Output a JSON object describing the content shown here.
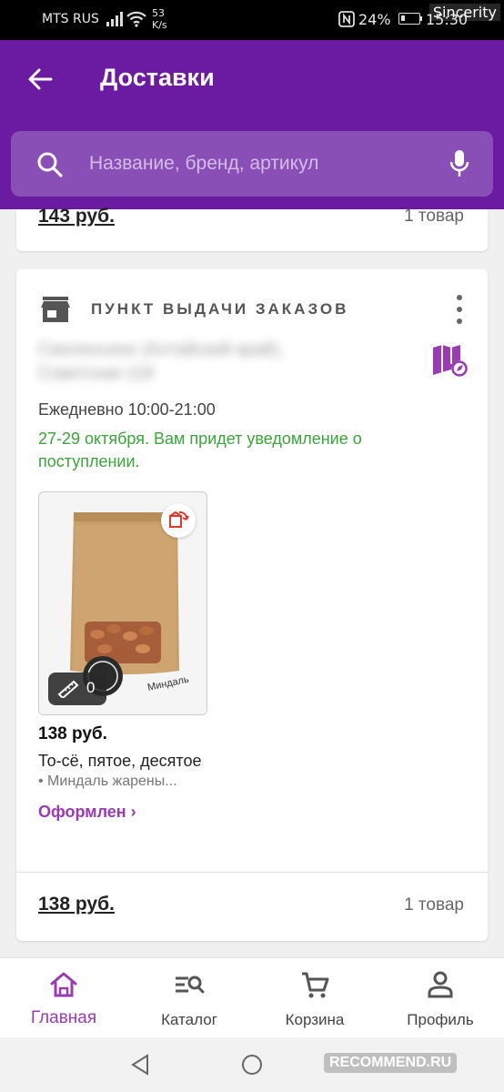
{
  "status_bar": {
    "carrier": "MTS RUS",
    "speed_value": "53",
    "speed_unit": "K/s",
    "battery": "24%",
    "time": "15:30",
    "watermark": "Sincerity"
  },
  "header": {
    "title": "Доставки",
    "back_icon": "arrow-left-icon"
  },
  "search": {
    "placeholder": "Название, бренд, артикул",
    "icon": "search-icon",
    "mic_icon": "microphone-icon"
  },
  "previous_card": {
    "total": "143 руб.",
    "count": "1 товар"
  },
  "pickup_card": {
    "title": "ПУНКТ ВЫДАЧИ ЗАКАЗОВ",
    "address": "Смоленское (Алтайский край), Советская 118",
    "hours": "Ежедневно 10:00-21:00",
    "note": "27-29 октября. Вам придет уведомление о поступлении.",
    "product": {
      "price": "138 руб.",
      "name": "То-сё, пятое, десятое",
      "subtitle": "• Миндаль жарены...",
      "status": "Оформлен ›",
      "size_count": "0"
    },
    "total": "138 руб.",
    "count": "1 товар",
    "colors": {
      "accent": "#9b3ab5",
      "note_green": "#3aa63a"
    }
  },
  "bottom_nav": {
    "items": [
      {
        "label": "Главная",
        "icon": "home-icon",
        "active": true
      },
      {
        "label": "Каталог",
        "icon": "catalog-search-icon",
        "active": false
      },
      {
        "label": "Корзина",
        "icon": "cart-icon",
        "active": false
      },
      {
        "label": "Профиль",
        "icon": "person-icon",
        "active": false
      }
    ]
  },
  "watermark_bottom": "RECOMMEND.RU",
  "colors": {
    "header": "#6a1ba1",
    "search_bg": "#8a4fb6"
  }
}
